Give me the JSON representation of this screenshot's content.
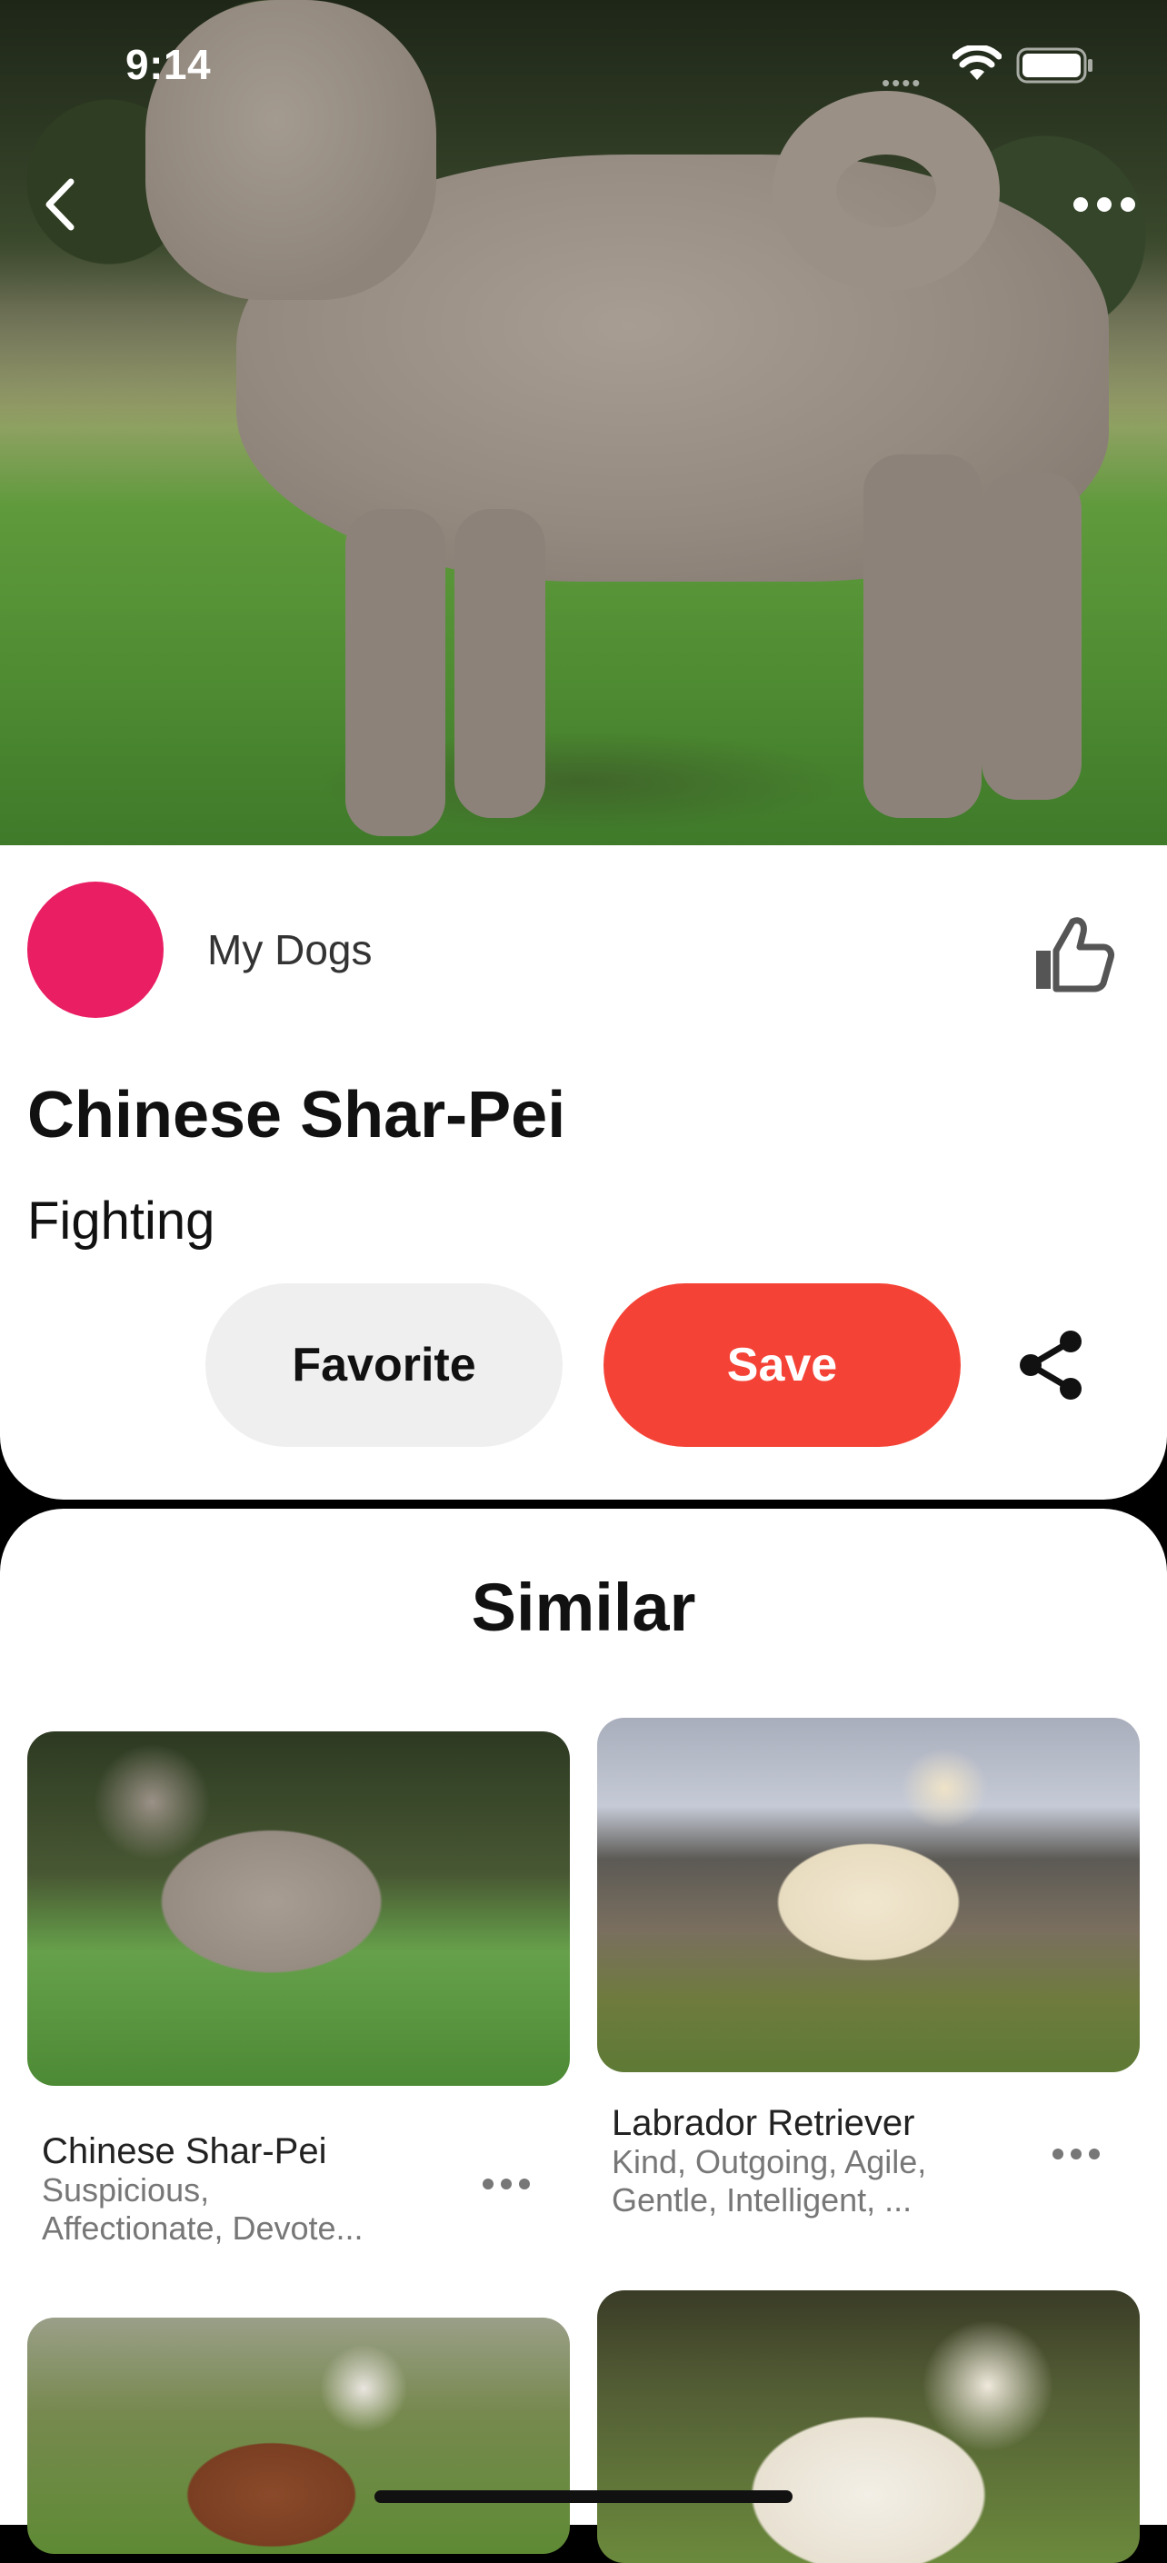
{
  "status_bar": {
    "time": "9:14"
  },
  "icons": {
    "back": "chevron-left-icon",
    "more": "ellipsis-icon",
    "like": "thumbs-up-icon",
    "share": "share-icon",
    "wifi": "wifi-icon",
    "battery": "battery-icon"
  },
  "detail": {
    "board_name": "My Dogs",
    "title": "Chinese Shar-Pei",
    "subtitle": "Fighting",
    "favorite_label": "Favorite",
    "save_label": "Save",
    "avatar_color": "#e91e63",
    "save_color": "#f44336"
  },
  "similar": {
    "heading": "Similar",
    "items": [
      {
        "name": "Chinese Shar-Pei",
        "desc_line1": "Suspicious,",
        "desc_line2": "Affectionate, Devote..."
      },
      {
        "name": "Labrador Retriever",
        "desc_line1": "Kind, Outgoing, Agile,",
        "desc_line2": "Gentle, Intelligent, ..."
      }
    ]
  }
}
